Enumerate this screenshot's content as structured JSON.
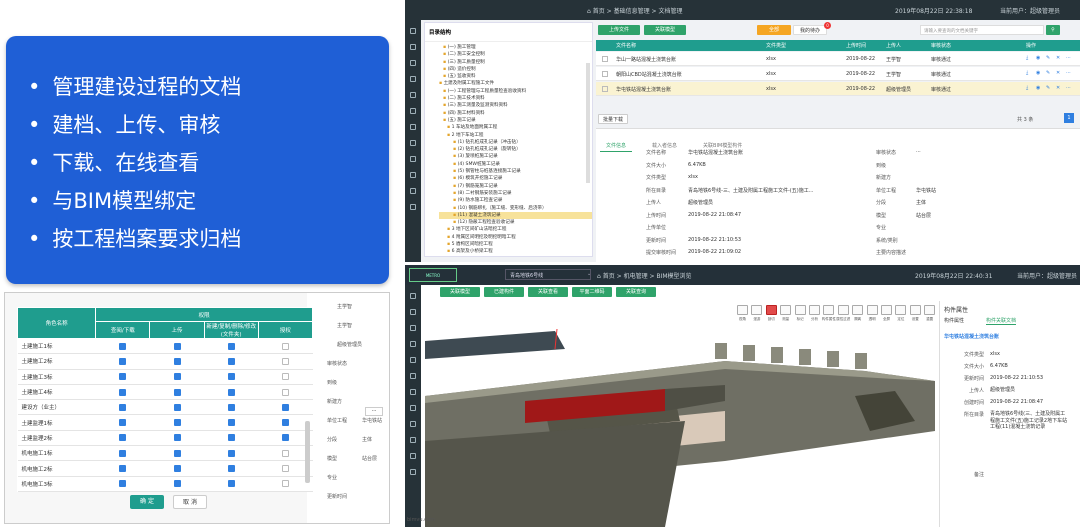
{
  "features": [
    "管理建设过程的文档",
    "建档、上传、审核",
    "下载、在线查看",
    "与BIM模型绑定",
    "按工程档案要求归档"
  ],
  "perm": {
    "col_role": "角色名称",
    "col_group": "权限",
    "cols": [
      "查阅/下载",
      "上传",
      "新建/复制/删除/修改(文件夹)",
      "授权"
    ],
    "rows": [
      {
        "name": "土建施工1标",
        "c": [
          1,
          1,
          1,
          0
        ]
      },
      {
        "name": "土建施工2标",
        "c": [
          1,
          1,
          1,
          0
        ]
      },
      {
        "name": "土建施工3标",
        "c": [
          1,
          1,
          1,
          0
        ]
      },
      {
        "name": "土建施工4标",
        "c": [
          1,
          1,
          1,
          0
        ]
      },
      {
        "name": "建设方（业主）",
        "c": [
          1,
          1,
          1,
          1
        ]
      },
      {
        "name": "土建监理1标",
        "c": [
          1,
          1,
          1,
          1
        ]
      },
      {
        "name": "土建监理2标",
        "c": [
          1,
          1,
          1,
          1
        ]
      },
      {
        "name": "机电施工1标",
        "c": [
          1,
          1,
          1,
          0
        ]
      },
      {
        "name": "机电施工2标",
        "c": [
          1,
          1,
          1,
          0
        ]
      },
      {
        "name": "机电施工3标",
        "c": [
          1,
          1,
          1,
          0
        ]
      }
    ],
    "ok": "确 定",
    "cancel": "取 消",
    "bg_right": [
      "主学智",
      "主学智",
      "超级管理员",
      "审核状态",
      "到级",
      "新建方",
      "单位工程",
      "分段",
      "模型",
      "专业",
      "更新时间"
    ],
    "bg_right2": [
      "",
      "",
      "",
      "",
      "",
      "",
      "华屯铁站",
      "主体",
      "站台层",
      "",
      ""
    ]
  },
  "s1": {
    "nav": [
      "首页",
      "基础信息管理",
      "文档管理"
    ],
    "time": "2019年08月22日 22:38:18",
    "user": "当前用户：超级管理员",
    "tree_title": "目录结构",
    "tree": [
      "(一) 施工管理",
      "(二) 施工安全控制",
      "(三) 施工质量控制",
      "(四) 造价控制",
      "(五) 监收资料",
      "土建及附属工程施工文件",
      "(一) 工程管理与工程质量检查验收资料",
      "(二) 施工技术资料",
      "(三) 施工测量及监测资料资料",
      "(四) 施工材料资料",
      "(五) 施工记录",
      "1 车站及地面附属工程",
      "2 地下车站工程",
      "(1) 钻孔桩成孔记录（冲击钻）",
      "(2) 钻孔桩成孔记录（旋转钻）",
      "(3) 旋喷桩施工记录",
      "(4) SMW桩施工记录",
      "(5) 钢管柱与桩基连接施工记录",
      "(6) 模筑开挖施工记录",
      "(7) 钢筋笼施工记录",
      "(8) 二衬钢筋安装施工记录",
      "(9) 防水施工检查记录",
      "(10) 钢筋绑扎（施工缝、变形缝、后浇带）",
      "(11) 混凝土浇筑记录",
      "(12) 隐蔽工程检查验收记录",
      "3 地下区间矿山法暗挖工程",
      "4 附属区间明挖及明挖明暗工程",
      "5 盾构区间暗挖工程",
      "6 高架及小桥梁工程"
    ],
    "upload": "上传文件",
    "newfolder": "关联模型",
    "tab_all": "全部",
    "tab_pending": "我的待办",
    "badge": "0",
    "search_ph": "请输入要查询的文档关键字",
    "cols": [
      "文件名称",
      "文件类型",
      "上传时间",
      "上传人",
      "审核状态",
      "操作"
    ],
    "rows": [
      {
        "name": "华山一路站混凝土浇筑台账",
        "type": "xlsx",
        "date": "2019-08-22",
        "user": "王学智",
        "status": "审核通过"
      },
      {
        "name": "朝阳山CBD站混凝土浇筑台账",
        "type": "xlsx",
        "date": "2019-08-22",
        "user": "王学智",
        "status": "审核通过"
      },
      {
        "name": "华屯铁站混凝土浇筑台账",
        "type": "xlsx",
        "date": "2019-08-22",
        "user": "超级管理员",
        "status": "审核通过"
      }
    ],
    "batch": "批量下载",
    "total": "共 3 条",
    "dtabs": [
      "文件信息",
      "载入者信息",
      "关联BIM模型构件"
    ],
    "details": [
      [
        "文件名称",
        "华屯铁站混凝土浇筑台账",
        "审核状态",
        "···"
      ],
      [
        "文件大小",
        "6.47KB",
        "到级",
        ""
      ],
      [
        "文件类型",
        "xlsx",
        "新建方",
        ""
      ],
      [
        "所在目录",
        "青岛地铁6号线-三、土建及附属工程施工文件-(五)施工...",
        "单位工程",
        "华屯铁站"
      ],
      [
        "上传人",
        "超级管理员",
        "分段",
        "主体"
      ],
      [
        "上传时间",
        "2019-08-22 21:08:47",
        "模型",
        "站台层"
      ],
      [
        "上传单位",
        "",
        "专业",
        ""
      ],
      [
        "更新时间",
        "2019-08-22 21:10:53",
        "系统/类别",
        ""
      ],
      [
        "提交审核时间",
        "2019-08-22 21:09:02",
        "主要内容描述",
        ""
      ]
    ]
  },
  "s2": {
    "project": "青岛地铁6号线",
    "nav": [
      "首页",
      "机电管理",
      "BIM模型浏览"
    ],
    "time": "2019年08月22日 22:40:31",
    "user": "当前用户：超级管理员",
    "btns": [
      "关联模型",
      "已建构件",
      "关联查看",
      "平面二维码",
      "关联查询"
    ],
    "tools": [
      "视角",
      "漫游",
      "剖切",
      "测量",
      "标记",
      "分析",
      "构件属性",
      "属性过滤",
      "隔离",
      "透明",
      "全屏",
      "定位",
      "设置",
      "重置"
    ],
    "panel_title": "构件属性",
    "ptabs": [
      "构件属性",
      "构件关联文档"
    ],
    "doc_name": "华屯铁站混凝土浇筑台账",
    "pinfo": [
      [
        "文件类型",
        "xlsx"
      ],
      [
        "文件大小",
        "6.47KB"
      ],
      [
        "更新时间",
        "2019-08-22 21:10:53"
      ],
      [
        "上传人",
        "超级管理员"
      ],
      [
        "创建时间",
        "2019-08-22 21:08:47"
      ],
      [
        "所在目录",
        "青岛地铁6号线(三、土建及附属工程施工文件(五)施工记录2地下车站工程(11)混凝土浇筑记录"
      ],
      [
        "备注",
        ""
      ]
    ],
    "watermark": "bimvu.com"
  }
}
